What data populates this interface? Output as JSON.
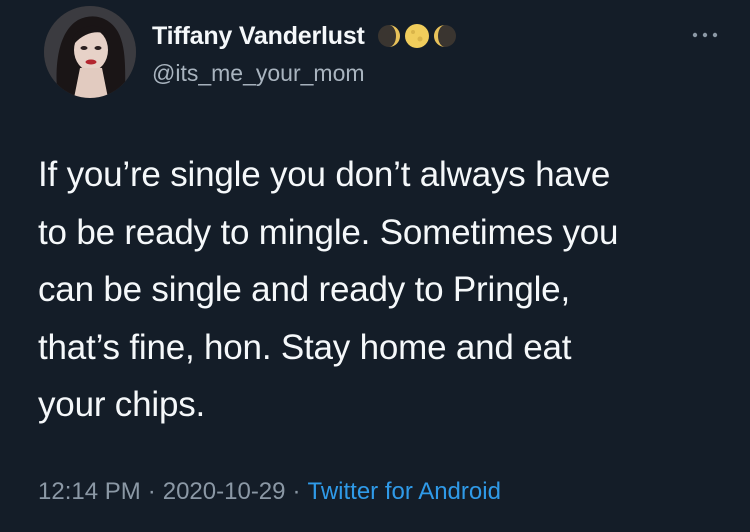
{
  "author": {
    "display_name": "Tiffany Vanderlust",
    "handle": "@its_me_your_mom",
    "emoji_icons": [
      "waxing-crescent-moon-icon",
      "full-moon-icon",
      "waning-crescent-moon-icon"
    ]
  },
  "tweet": {
    "lines": [
      "If you’re single you don’t always have",
      "to be ready to mingle. Sometimes you",
      "can be single and ready to Pringle,",
      "that’s fine, hon. Stay home and eat",
      "your chips."
    ]
  },
  "meta": {
    "time": "12:14 PM",
    "separator": "·",
    "date": "2020-10-29",
    "source": "Twitter for Android"
  },
  "colors": {
    "background": "#141d28",
    "text": "#f5f8fa",
    "secondary": "#8b98a5",
    "link": "#2f9ae8"
  }
}
